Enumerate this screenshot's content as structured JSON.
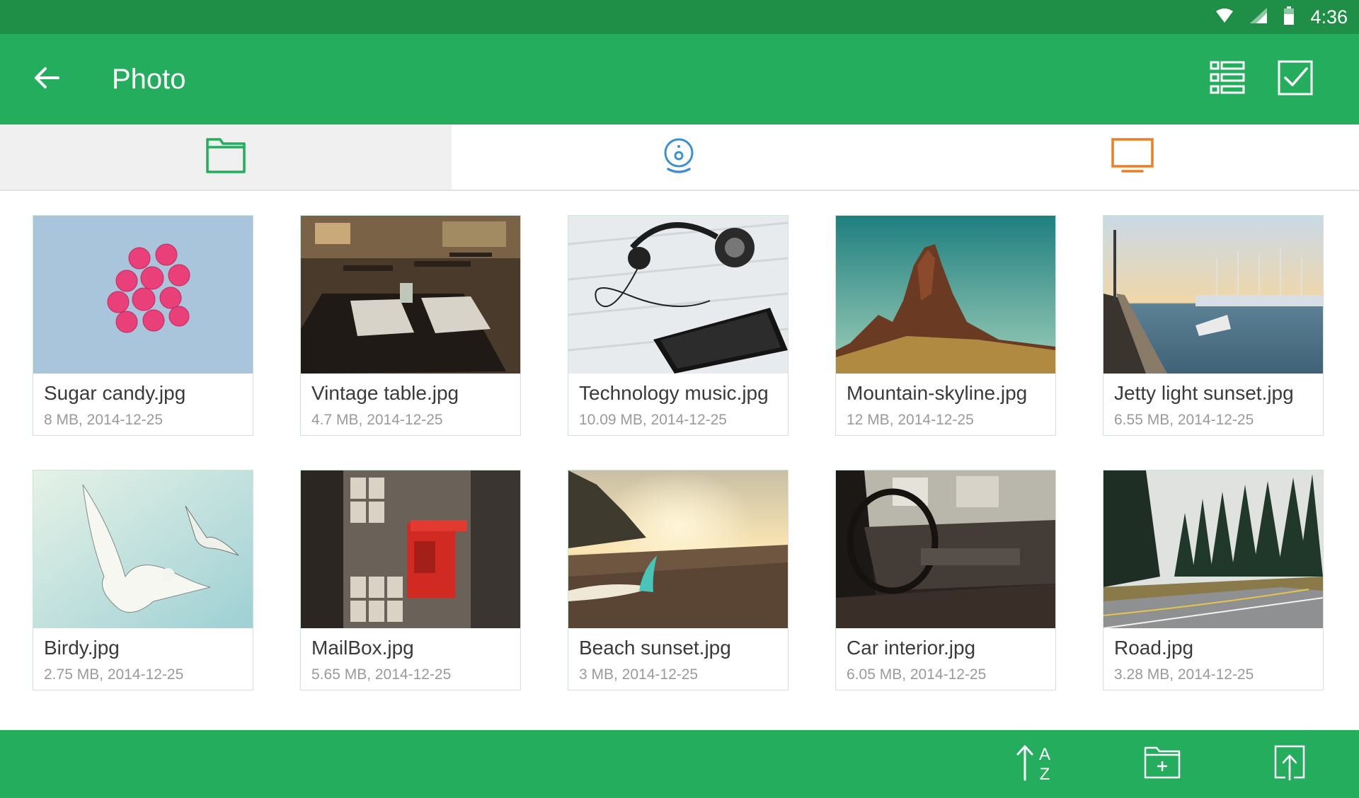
{
  "status_bar": {
    "time": "4:36",
    "icons": [
      "wifi-icon",
      "cell-signal-icon",
      "battery-icon"
    ]
  },
  "app_bar": {
    "title": "Photo",
    "icons": [
      "back-arrow-icon",
      "list-view-icon",
      "select-checkbox-icon"
    ]
  },
  "tabs": [
    {
      "icon": "folder-icon",
      "active": true
    },
    {
      "icon": "webcam-device-icon",
      "active": false
    },
    {
      "icon": "tv-icon",
      "active": false
    }
  ],
  "files": [
    {
      "name": "Sugar candy.jpg",
      "meta": "8 MB, 2014-12-25"
    },
    {
      "name": "Vintage table.jpg",
      "meta": "4.7 MB, 2014-12-25"
    },
    {
      "name": "Technology music.jpg",
      "meta": "10.09 MB, 2014-12-25"
    },
    {
      "name": "Mountain-skyline.jpg",
      "meta": "12 MB, 2014-12-25"
    },
    {
      "name": "Jetty light sunset.jpg",
      "meta": "6.55 MB, 2014-12-25"
    },
    {
      "name": "Birdy.jpg",
      "meta": "2.75 MB, 2014-12-25"
    },
    {
      "name": "MailBox.jpg",
      "meta": "5.65 MB, 2014-12-25"
    },
    {
      "name": "Beach sunset.jpg",
      "meta": "3 MB, 2014-12-25"
    },
    {
      "name": "Car interior.jpg",
      "meta": "6.05 MB, 2014-12-25"
    },
    {
      "name": "Road.jpg",
      "meta": "3.28 MB, 2014-12-25"
    }
  ],
  "bottom_bar": {
    "sort_label_top": "A",
    "sort_label_bottom": "Z",
    "icons": [
      "sort-az-icon",
      "new-folder-icon",
      "upload-icon"
    ]
  },
  "colors": {
    "status_bar": "#1f8f48",
    "primary": "#23ad5c",
    "tab_folder": "#23ad5c",
    "tab_device": "#3a8fd6",
    "tab_tv": "#f07d22"
  }
}
